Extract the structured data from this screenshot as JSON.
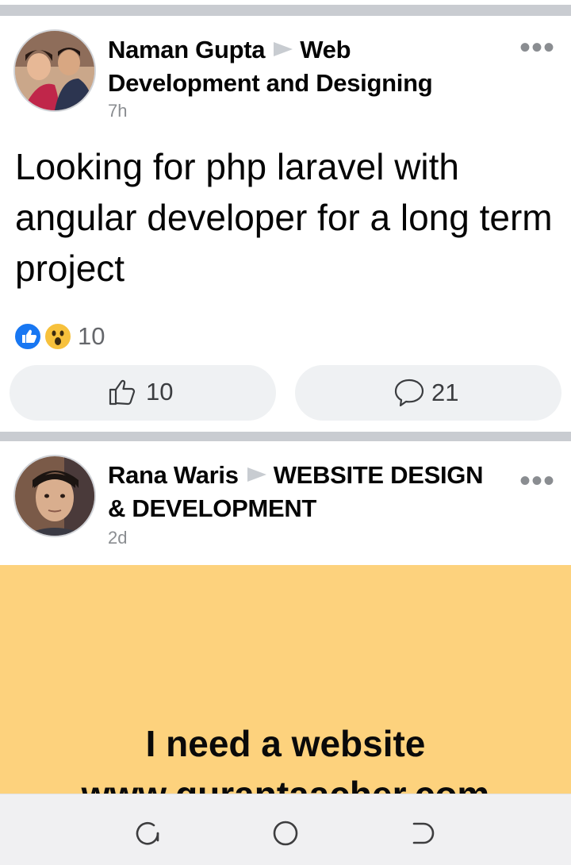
{
  "posts": [
    {
      "author": "Naman Gupta",
      "group": "Web Development and Designing",
      "time": "7h",
      "text": "Looking for php laravel with angular developer for a long term project",
      "reaction_count": "10",
      "like_count": "10",
      "comment_count": "21"
    },
    {
      "author": "Rana Waris",
      "group": "WEBSITE DESIGN & DEVELOPMENT",
      "time": "2d",
      "text_line1": "I need a website",
      "text_line2": "www.qurantaacher.com",
      "background_color": "#fdd27d"
    }
  ],
  "colors": {
    "like_blue": "#1877f2",
    "meta_gray": "#8a8d91"
  },
  "icons": [
    "more-icon",
    "like-reaction-icon",
    "wow-reaction-icon",
    "thumbs-up-icon",
    "comment-icon",
    "recents-icon",
    "home-icon",
    "back-icon"
  ]
}
